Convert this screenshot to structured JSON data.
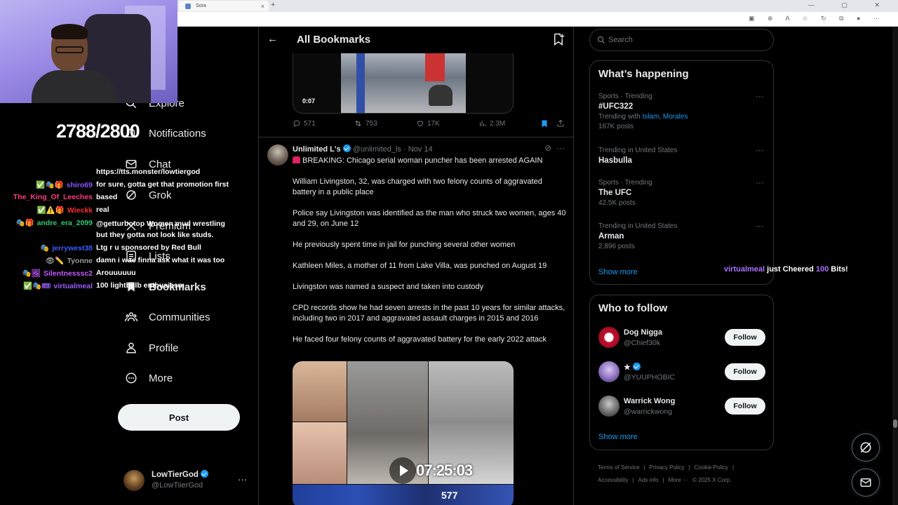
{
  "browser": {
    "tab_title": "Sora",
    "new_tab_label": "+",
    "tab_close": "×",
    "window_controls": "— ▢ ✕"
  },
  "overlay": {
    "counter": "2788/2800",
    "chat": [
      {
        "name": "",
        "badges": "",
        "message": "https://tts.monster/lowtiergod",
        "color": "#ffffff"
      },
      {
        "name": "shiro69",
        "badges": "✅🎭🎁",
        "message": "for sure, gotta get that promotion first",
        "color": "#8a55ff"
      },
      {
        "name": "The_King_Of_Leeches",
        "badges": "",
        "message": "based",
        "color": "#ff3b7f"
      },
      {
        "name": "Wieckk",
        "badges": "✅⚠️🎁",
        "message": "real",
        "color": "#ff2e2e"
      },
      {
        "name": "andre_era_2099",
        "badges": "🎭🎁",
        "message": "@getturbotop Women mud wrestling but they gotta not look like studs.",
        "color": "#2ecc71"
      },
      {
        "name": "jerrywest38",
        "badges": "🎭",
        "message": "Ltg r u sponsored by Red Bull",
        "color": "#3b5bff"
      },
      {
        "name": "Tyonne",
        "badges": "👁✏️",
        "message": "damn i was finna ask what it was too",
        "color": "#9b9b9b"
      },
      {
        "name": "Silentnesssc2",
        "badges": "🎭🖼",
        "message": "Arouuuuuu",
        "color": "#c259ff"
      },
      {
        "name": "virtualmeal",
        "badges": "✅🎭🎟",
        "message": "100 lightbulb enthusiasm",
        "color": "#9b59ff"
      }
    ],
    "cheer": {
      "name": "virtualmeal",
      "middle": "just Cheered",
      "amount": "100",
      "suffix": "Bits!"
    }
  },
  "nav": {
    "items": [
      {
        "label": "Explore",
        "icon": "search-icon"
      },
      {
        "label": "Notifications",
        "icon": "bell-icon"
      },
      {
        "label": "Chat",
        "icon": "mail-icon"
      },
      {
        "label": "Grok",
        "icon": "grok-icon"
      },
      {
        "label": "Premium",
        "icon": "x-logo-icon"
      },
      {
        "label": "Lists",
        "icon": "list-icon"
      },
      {
        "label": "Bookmarks",
        "icon": "bookmark-icon"
      },
      {
        "label": "Communities",
        "icon": "communities-icon"
      },
      {
        "label": "Profile",
        "icon": "profile-icon"
      },
      {
        "label": "More",
        "icon": "more-circle-icon"
      }
    ],
    "post_label": "Post",
    "account": {
      "name": "LowTierGod",
      "handle": "@LowTiierGod",
      "more": "···"
    }
  },
  "center": {
    "title": "All Bookmarks",
    "prev_tweet": {
      "duration": "0:07",
      "replies": "571",
      "reposts": "753",
      "likes": "17K",
      "views": "2.3M"
    },
    "tweet": {
      "name": "Unlimited L's",
      "handle": "@unlimited_ls",
      "date": "Nov 14",
      "separator": "·",
      "lines": [
        "BREAKING: Chicago serial woman puncher has been arrested AGAIN",
        "William Livingston, 32, was charged with two felony counts of aggravated battery in a public place",
        "Police say Livingston was identified as the man who struck two women, ages 40 and 29, on June 12",
        "He previously spent time in jail for punching several other women",
        "Kathleen Miles, a mother of 11 from Lake Villa, was punched on August 19",
        "Livingston was named a suspect and taken into custody",
        "CPD records show he had seven arrests in the past 10 years for similar attacks, including two in 2017 and aggravated assault charges in 2015 and 2016",
        "He faced four felony counts of aggravated battery for the early 2022 attack"
      ],
      "video_stamp": "07:25:03",
      "video_num": "577"
    }
  },
  "right": {
    "search_placeholder": "Search",
    "trends_title": "What’s happening",
    "trends": [
      {
        "context": "Sports · Trending",
        "name": "#UFC322",
        "sub_prefix": "Trending with ",
        "sub_links": "Islam, Morales",
        "sub": "167K posts"
      },
      {
        "context": "Trending in United States",
        "name": "Hasbulla",
        "sub_prefix": "",
        "sub_links": "",
        "sub": ""
      },
      {
        "context": "Sports · Trending",
        "name": "The UFC",
        "sub_prefix": "",
        "sub_links": "",
        "sub": "42.5K posts"
      },
      {
        "context": "Trending in United States",
        "name": "Arman",
        "sub_prefix": "",
        "sub_links": "",
        "sub": "2,896 posts"
      }
    ],
    "trends_more": "Show more",
    "follow_title": "Who to follow",
    "follow": [
      {
        "name": "Dog Nigga",
        "handle": "@Chief30k",
        "button": "Follow"
      },
      {
        "name": "★",
        "handle": "@YUUPHOBIC",
        "button": "Follow"
      },
      {
        "name": "Warrick Wong",
        "handle": "@warrickwong",
        "button": "Follow"
      }
    ],
    "follow_more": "Show more",
    "footer": [
      "Terms of Service",
      "|",
      "Privacy Policy",
      "|",
      "Cookie Policy",
      "|",
      "Accessibility",
      "|",
      "Ads info",
      "|",
      "More ···",
      "© 2025 X Corp."
    ]
  },
  "colors": {
    "accent": "#1d9bf0",
    "bg": "#000000",
    "border": "#2f3336",
    "muted": "#71767b"
  }
}
